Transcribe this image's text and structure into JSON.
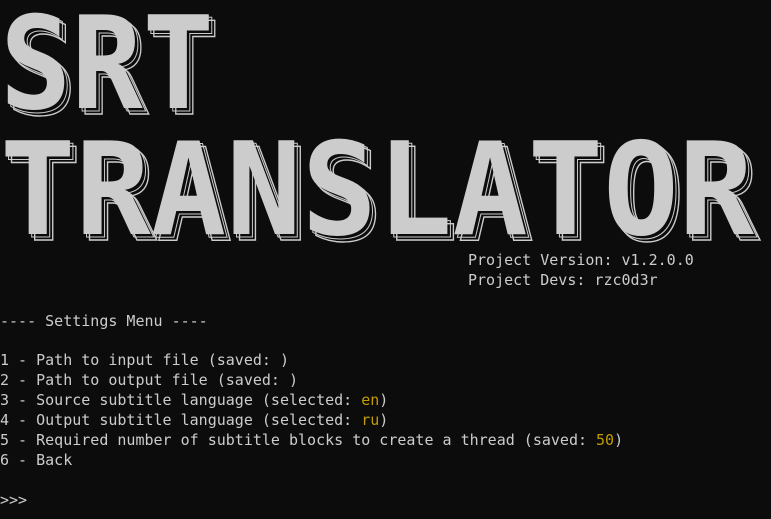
{
  "banner": {
    "line1": "SRT",
    "line2": "TRANSLATOR",
    "fill_color": "#cccccc",
    "outline_color": "#cccccc"
  },
  "meta": {
    "version_label": "Project Version: v1.2.0.0",
    "devs_label": "Project Devs: rzc0d3r"
  },
  "menu": {
    "header": "---- Settings Menu ----",
    "items": [
      {
        "prefix": "1 - Path to input file (saved: ",
        "value": "",
        "suffix": ")"
      },
      {
        "prefix": "2 - Path to output file (saved: ",
        "value": "",
        "suffix": ")"
      },
      {
        "prefix": "3 - Source subtitle language (selected: ",
        "value": "en",
        "suffix": ")"
      },
      {
        "prefix": "4 - Output subtitle language (selected: ",
        "value": "ru",
        "suffix": ")"
      },
      {
        "prefix": "5 - Required number of subtitle blocks to create a thread (saved: ",
        "value": "50",
        "suffix": ")"
      },
      {
        "prefix": "6 - Back",
        "value": "",
        "suffix": ""
      }
    ],
    "highlight_color": "#c19c00"
  },
  "prompt": {
    "text": ">>>"
  }
}
